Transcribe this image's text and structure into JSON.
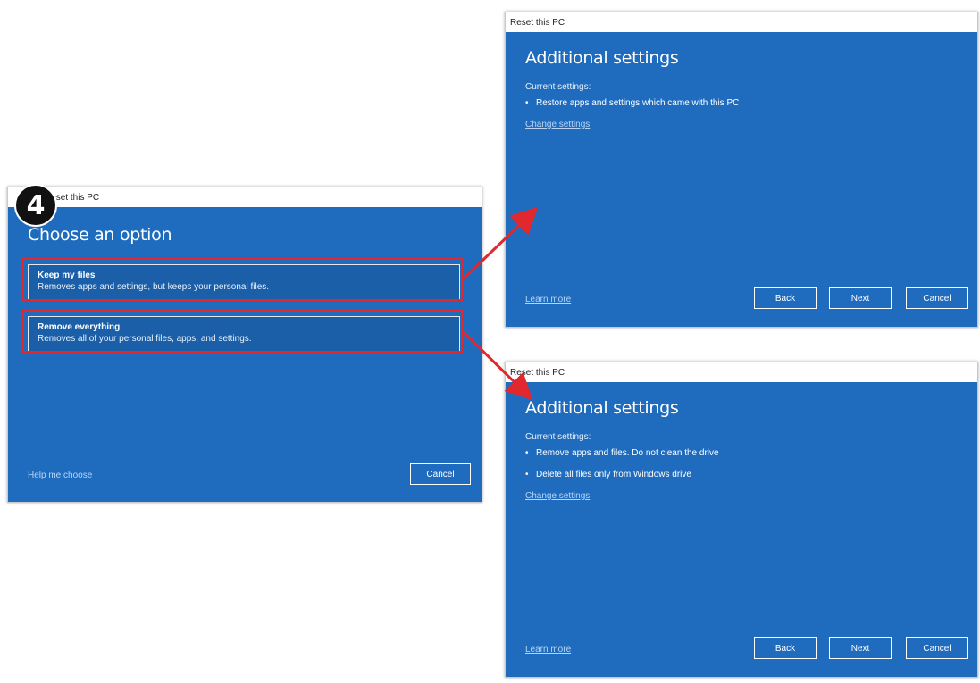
{
  "step_number": "4",
  "left_window": {
    "title": "Reset this PC",
    "heading": "Choose an option",
    "options": [
      {
        "title": "Keep my files",
        "desc": "Removes apps and settings, but keeps your personal files."
      },
      {
        "title": "Remove everything",
        "desc": "Removes all of your personal files, apps, and settings."
      }
    ],
    "help_link": "Help me choose",
    "cancel": "Cancel"
  },
  "top_right_window": {
    "title": "Reset this PC",
    "heading": "Additional settings",
    "current_label": "Current settings:",
    "bullets": [
      "Restore apps and settings which came with this PC"
    ],
    "change_link": "Change settings",
    "learn_link": "Learn more",
    "back": "Back",
    "next": "Next",
    "cancel": "Cancel"
  },
  "bottom_right_window": {
    "title": "Reset this PC",
    "heading": "Additional settings",
    "current_label": "Current settings:",
    "bullets": [
      "Remove apps and files. Do not clean the drive",
      "Delete all files only from Windows drive"
    ],
    "change_link": "Change settings",
    "learn_link": "Learn more",
    "back": "Back",
    "next": "Next",
    "cancel": "Cancel"
  },
  "colors": {
    "window_blue": "#1f6cbf",
    "highlight_red": "#e0282e"
  }
}
